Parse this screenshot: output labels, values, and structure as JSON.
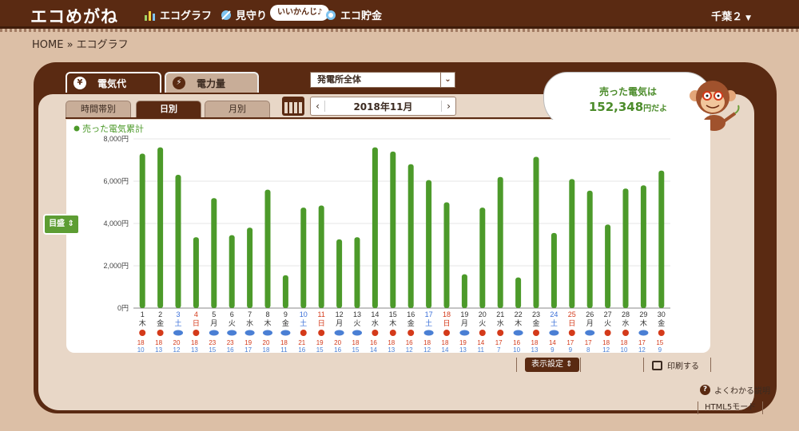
{
  "header": {
    "logo": "エコめがね",
    "nav": [
      {
        "label": "エコグラフ",
        "icon": "bar-chart-icon"
      },
      {
        "label": "見守り",
        "icon": "satellite-icon"
      },
      {
        "label": "エコ貯金",
        "icon": "coin-icon"
      }
    ],
    "bubble": "いいかんじ♪",
    "user": "千葉２"
  },
  "breadcrumb": "HOME » エコグラフ",
  "tabs": {
    "main": [
      {
        "label": "電気代",
        "icon": "yen-icon"
      },
      {
        "label": "電力量",
        "icon": "bolt-icon"
      }
    ],
    "plant_select": "発電所全体",
    "sub": [
      "時間帯別",
      "日別",
      "月別"
    ],
    "date": "2018年11月"
  },
  "sold": {
    "line1": "売った電気は",
    "value": "152,348",
    "unit": "円だよ"
  },
  "scale_button": "目盛",
  "colors": {
    "bar": "#4c9a2a",
    "sun": "#d43a1a",
    "cloud": "#4a7fd4",
    "saturday": "#3a6fd8",
    "sunday": "#d43a1a"
  },
  "chart_data": {
    "type": "bar",
    "title": "売った電気累計",
    "ylim": [
      0,
      8000
    ],
    "yticks": [
      "0円",
      "2,000円",
      "4,000円",
      "6,000円",
      "8,000円"
    ],
    "categories": [
      "1",
      "2",
      "3",
      "4",
      "5",
      "6",
      "7",
      "8",
      "9",
      "10",
      "11",
      "12",
      "13",
      "14",
      "15",
      "16",
      "17",
      "18",
      "19",
      "20",
      "21",
      "22",
      "23",
      "24",
      "25",
      "26",
      "27",
      "28",
      "29",
      "30"
    ],
    "weekdays": [
      "木",
      "金",
      "土",
      "日",
      "月",
      "火",
      "水",
      "木",
      "金",
      "土",
      "日",
      "月",
      "火",
      "水",
      "木",
      "金",
      "土",
      "日",
      "月",
      "火",
      "水",
      "木",
      "金",
      "土",
      "日",
      "月",
      "火",
      "水",
      "木",
      "金"
    ],
    "values": [
      7300,
      7600,
      6300,
      3350,
      5200,
      3450,
      3800,
      5600,
      1550,
      4750,
      4850,
      3250,
      3350,
      7600,
      7400,
      6800,
      6050,
      5000,
      1600,
      4750,
      6200,
      1450,
      7150,
      3550,
      6100,
      5550,
      3950,
      5650,
      5800,
      6500
    ],
    "weather": [
      "sun",
      "sun",
      "cloud",
      "sun",
      "cloud",
      "cloud",
      "cloud",
      "cloud",
      "cloud",
      "sun",
      "sun",
      "cloud",
      "cloud",
      "sun",
      "sun",
      "sun",
      "cloud",
      "sun",
      "cloud",
      "sun",
      "sun",
      "cloud",
      "sun",
      "cloud",
      "sun",
      "cloud",
      "sun",
      "sun",
      "cloud",
      "sun"
    ],
    "high": [
      "18",
      "18",
      "20",
      "18",
      "23",
      "23",
      "19",
      "20",
      "18",
      "21",
      "19",
      "20",
      "18",
      "16",
      "18",
      "16",
      "18",
      "18",
      "19",
      "14",
      "17",
      "16",
      "18",
      "14",
      "17",
      "17",
      "18",
      "18",
      "17",
      "15"
    ],
    "low": [
      "10",
      "13",
      "12",
      "13",
      "15",
      "16",
      "17",
      "18",
      "11",
      "16",
      "15",
      "16",
      "15",
      "14",
      "13",
      "12",
      "12",
      "14",
      "13",
      "11",
      "7",
      "10",
      "13",
      "9",
      "9",
      "8",
      "12",
      "10",
      "12",
      "9"
    ]
  },
  "bottom": {
    "display_settings": "表示設定",
    "print": "印刷する",
    "help": "よくわかる説明",
    "html5": "HTML5モード"
  }
}
